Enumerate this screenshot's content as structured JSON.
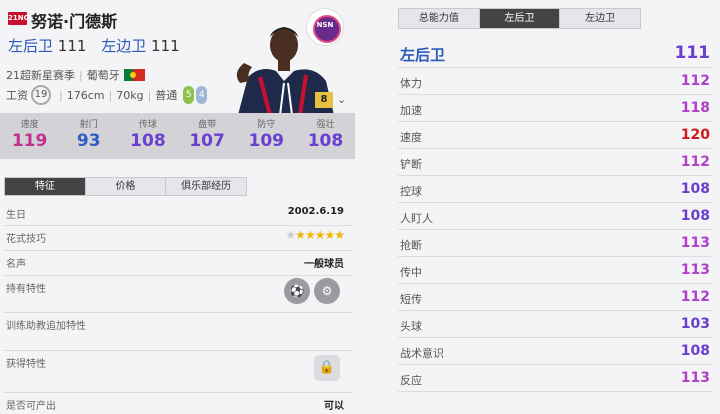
{
  "player": {
    "season_badge": "21NG",
    "name": "努诺·门德斯",
    "positions": [
      {
        "name": "左后卫",
        "value": "111"
      },
      {
        "name": "左边卫",
        "value": "111"
      }
    ],
    "season": "21超新星赛季",
    "nationality": "葡萄牙",
    "wage_label": "工资",
    "wage": "19",
    "height": "176cm",
    "weight": "70kg",
    "body_type": "普通",
    "weak_foot_left": "5",
    "weak_foot_right": "4",
    "grade": "8",
    "club_logo_text": "NSN"
  },
  "summary_stats": [
    {
      "label": "速度",
      "value": "119",
      "color": "#c0318c"
    },
    {
      "label": "射门",
      "value": "93",
      "color": "#2f5fc4"
    },
    {
      "label": "传球",
      "value": "108",
      "color": "#6a3fd0"
    },
    {
      "label": "盘带",
      "value": "107",
      "color": "#6a3fd0"
    },
    {
      "label": "防守",
      "value": "109",
      "color": "#6a3fd0"
    },
    {
      "label": "强壮",
      "value": "108",
      "color": "#6a3fd0"
    }
  ],
  "left_tabs": [
    "特征",
    "价格",
    "俱乐部经历"
  ],
  "features": {
    "birthday_label": "生日",
    "birthday": "2002.6.19",
    "skill_label": "花式技巧",
    "skill_stars": 5,
    "skill_stars_max": 6,
    "reputation_label": "名声",
    "reputation": "一般球员",
    "traits_label": "持有特性",
    "coach_label": "训练助教追加特性",
    "acquired_label": "获得特性",
    "sellable_label": "是否可产出",
    "sellable": "可以"
  },
  "right_tabs": [
    "总能力值",
    "左后卫",
    "左边卫"
  ],
  "right_tab_active": 1,
  "attribute_header": {
    "label": "左后卫",
    "value": "111"
  },
  "attributes": [
    {
      "label": "体力",
      "value": "112",
      "color": "#b040c8"
    },
    {
      "label": "加速",
      "value": "118",
      "color": "#b040c8"
    },
    {
      "label": "速度",
      "value": "120",
      "color": "#d01818"
    },
    {
      "label": "铲断",
      "value": "112",
      "color": "#b040c8"
    },
    {
      "label": "控球",
      "value": "108",
      "color": "#6a3fd0"
    },
    {
      "label": "人盯人",
      "value": "108",
      "color": "#6a3fd0"
    },
    {
      "label": "抢断",
      "value": "113",
      "color": "#b040c8"
    },
    {
      "label": "传中",
      "value": "113",
      "color": "#b040c8"
    },
    {
      "label": "短传",
      "value": "112",
      "color": "#b040c8"
    },
    {
      "label": "头球",
      "value": "103",
      "color": "#6a3fd0"
    },
    {
      "label": "战术意识",
      "value": "108",
      "color": "#6a3fd0"
    },
    {
      "label": "反应",
      "value": "113",
      "color": "#b040c8"
    }
  ]
}
